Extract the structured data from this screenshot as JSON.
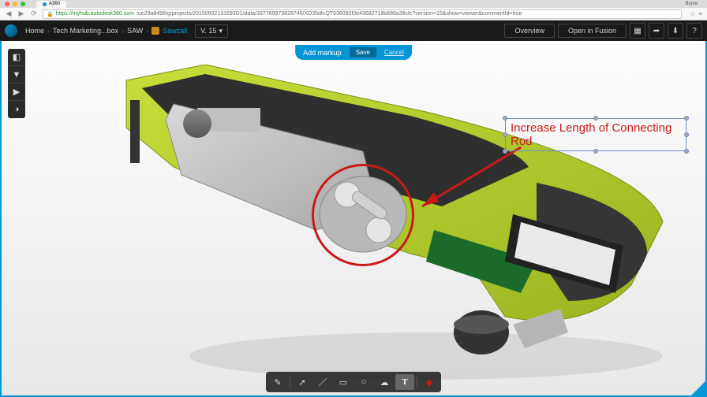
{
  "browser": {
    "tab_title": "A360",
    "user_label": "Bryce",
    "url_host": "https://myhub.autodesk360.com",
    "url_path": "/ue29a8498/g/projects/20150602131693D1/data/337769973828746/XD35dfcQT936092f0e43682719b888a39cfc?version=15&show=viewer&commentId=true"
  },
  "header": {
    "breadcrumbs": [
      {
        "label": "Home",
        "active": false
      },
      {
        "label": "Tech Marketing...box",
        "active": false
      },
      {
        "label": "SAW",
        "active": false
      },
      {
        "label": "Sawzall",
        "active": true,
        "icon": true
      }
    ],
    "version_label": "V. 15",
    "overview_label": "Overview",
    "open_in_fusion_label": "Open in Fusion"
  },
  "markup_bar": {
    "add_markup_label": "Add markup",
    "save_label": "Save",
    "cancel_label": "Cancel"
  },
  "annotation": {
    "text": "Increase Length of Connecting Rod",
    "color": "#c81919"
  },
  "bottom_toolbar": {
    "text_tool_label": "T"
  }
}
